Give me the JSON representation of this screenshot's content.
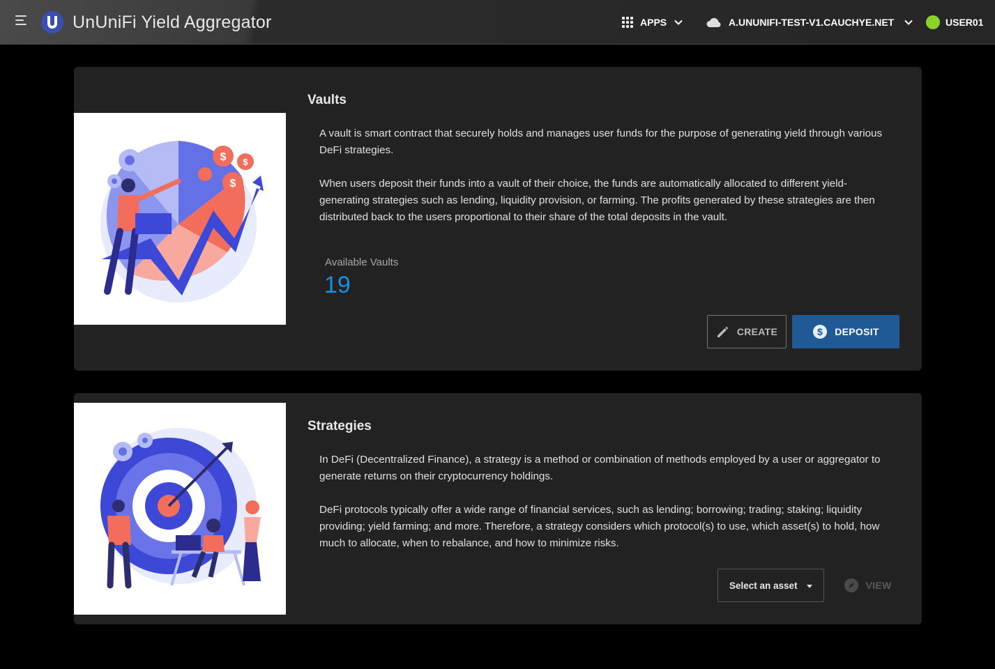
{
  "header": {
    "app_title": "UnUniFi Yield Aggregator",
    "logo_letter": "U",
    "apps_label": "APPS",
    "network_label": "A.UNUNIFI-TEST-V1.CAUCHYE.NET",
    "user_label": "USER01",
    "status_color": "#8bd32a"
  },
  "vaults": {
    "title": "Vaults",
    "paragraph1": "A vault is smart contract that securely holds and manages user funds for the purpose of generating yield through various DeFi strategies.",
    "paragraph2": "When users deposit their funds into a vault of their choice, the funds are automatically allocated to different yield-generating strategies such as lending, liquidity provision, or farming. The profits generated by these strategies are then distributed back to the users proportional to their share of the total deposits in the vault.",
    "stat_label": "Available Vaults",
    "stat_value": "19",
    "create_label": "CREATE",
    "deposit_label": "DEPOSIT"
  },
  "strategies": {
    "title": "Strategies",
    "paragraph1": "In DeFi (Decentralized Finance), a strategy is a method or combination of methods employed by a user or aggregator to generate returns on their cryptocurrency holdings.",
    "paragraph2": "DeFi protocols typically offer a wide range of financial services, such as lending; borrowing; trading; staking; liquidity providing; yield farming; and more. Therefore, a strategy considers which protocol(s) to use, which asset(s) to hold, how much to allocate, when to rebalance, and how to minimize risks.",
    "select_label": "Select an asset",
    "view_label": "VIEW"
  },
  "colors": {
    "accent": "#1a8fe0",
    "primary_button": "#1f5a96",
    "illustration_blue": "#3d48d6",
    "illustration_coral": "#f26d5b"
  }
}
